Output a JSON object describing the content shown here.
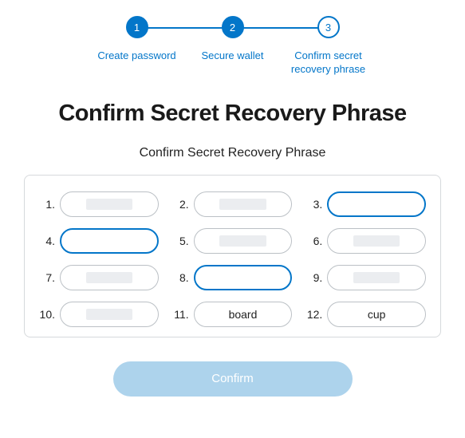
{
  "stepper": {
    "steps": [
      {
        "number": "1",
        "label": "Create password",
        "state": "filled"
      },
      {
        "number": "2",
        "label": "Secure wallet",
        "state": "filled"
      },
      {
        "number": "3",
        "label": "Confirm secret recovery phrase",
        "state": "outline"
      }
    ]
  },
  "page": {
    "title": "Confirm Secret Recovery Phrase",
    "subtitle": "Confirm Secret Recovery Phrase"
  },
  "phrase": {
    "words": [
      {
        "num": "1.",
        "value": "",
        "active": false,
        "redacted": true
      },
      {
        "num": "2.",
        "value": "",
        "active": false,
        "redacted": true
      },
      {
        "num": "3.",
        "value": "",
        "active": true,
        "redacted": false
      },
      {
        "num": "4.",
        "value": "",
        "active": true,
        "redacted": false
      },
      {
        "num": "5.",
        "value": "",
        "active": false,
        "redacted": true
      },
      {
        "num": "6.",
        "value": "",
        "active": false,
        "redacted": true
      },
      {
        "num": "7.",
        "value": "",
        "active": false,
        "redacted": true
      },
      {
        "num": "8.",
        "value": "",
        "active": true,
        "redacted": false
      },
      {
        "num": "9.",
        "value": "",
        "active": false,
        "redacted": true
      },
      {
        "num": "10.",
        "value": "",
        "active": false,
        "redacted": true
      },
      {
        "num": "11.",
        "value": "board",
        "active": false,
        "redacted": false
      },
      {
        "num": "12.",
        "value": "cup",
        "active": false,
        "redacted": false
      }
    ]
  },
  "actions": {
    "confirm_label": "Confirm"
  }
}
